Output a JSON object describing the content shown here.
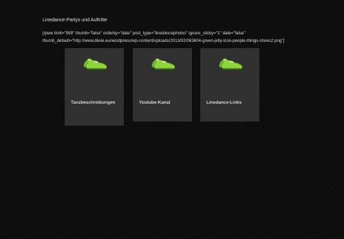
{
  "page": {
    "title": "Linedance-Partys und Auftritte",
    "shortcode_line1": "[rpwe limit=\"999\" thumb=\"false\" orderby=\"date\" post_type=\"linedancephotos\" ignore_sticky=\"1\" date=\"false\"",
    "shortcode_line2": "thumb_default=\"http://www.diwie.eu/wordpress/wp-content/uploads/2013/02/063604-green-jelly-icon-people-things-shoes2.png\"]"
  },
  "cards": [
    {
      "label": "Tanzbeschreibungen",
      "icon": "green-shoes-icon"
    },
    {
      "label": "Youtube-Kanal",
      "icon": "green-shoes-icon"
    },
    {
      "label": "Linedance-Links",
      "icon": "green-shoes-icon"
    }
  ],
  "colors": {
    "background": "#0b0b0b",
    "card": "#303030",
    "shoe_green": "#8fd43a",
    "shoe_dark": "#4f8a1c"
  }
}
